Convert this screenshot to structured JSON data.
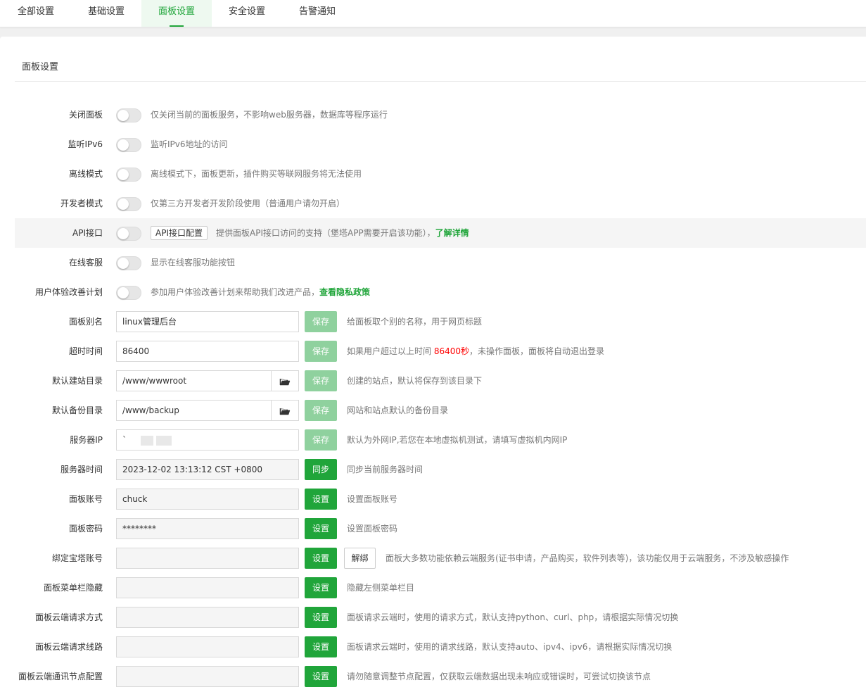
{
  "tabs": [
    {
      "label": "全部设置",
      "active": false
    },
    {
      "label": "基础设置",
      "active": false
    },
    {
      "label": "面板设置",
      "active": true
    },
    {
      "label": "安全设置",
      "active": false
    },
    {
      "label": "告警通知",
      "active": false
    }
  ],
  "panel": {
    "title": "面板设置"
  },
  "toggles": [
    {
      "label": "关闭面板",
      "desc": "仅关闭当前的面板服务，不影响web服务器，数据库等程序运行"
    },
    {
      "label": "监听IPv6",
      "desc": "监听IPv6地址的访问"
    },
    {
      "label": "离线模式",
      "desc": "离线模式下，面板更新，插件购买等联网服务将无法使用"
    },
    {
      "label": "开发者模式",
      "desc": "仅第三方开发者开发阶段使用（普通用户请勿开启）"
    },
    {
      "label": "API接口",
      "button": "API接口配置",
      "desc": "提供面板API接口访问的支持（堡塔APP需要开启该功能），",
      "link": "了解详情"
    },
    {
      "label": "在线客服",
      "desc": "显示在线客服功能按钮"
    },
    {
      "label": "用户体验改善计划",
      "desc": "参加用户体验改善计划来帮助我们改进产品，",
      "link": "查看隐私政策"
    }
  ],
  "fields": {
    "alias": {
      "label": "面板别名",
      "value": "linux管理后台",
      "button": "保存",
      "desc": "给面板取个别的名称，用于网页标题"
    },
    "timeout": {
      "label": "超时时间",
      "value": "86400",
      "button": "保存",
      "desc_pre": "如果用户超过以上时间 ",
      "desc_red": "86400秒",
      "desc_post": "，未操作面板，面板将自动退出登录"
    },
    "site_dir": {
      "label": "默认建站目录",
      "value": "/www/wwwroot",
      "button": "保存",
      "desc": "创建的站点，默认将保存到该目录下"
    },
    "backup_dir": {
      "label": "默认备份目录",
      "value": "/www/backup",
      "button": "保存",
      "desc": "网站和站点默认的备份目录"
    },
    "server_ip": {
      "label": "服务器IP",
      "value": "`",
      "button": "保存",
      "desc": "默认为外网IP,若您在本地虚拟机测试，请填写虚拟机内网IP"
    },
    "server_time": {
      "label": "服务器时间",
      "value": "2023-12-02 13:13:12 CST +0800",
      "button": "同步",
      "desc": "同步当前服务器时间"
    },
    "account": {
      "label": "面板账号",
      "value": "chuck",
      "button": "设置",
      "desc": "设置面板账号"
    },
    "password": {
      "label": "面板密码",
      "value": "********",
      "button": "设置",
      "desc": "设置面板密码"
    },
    "bt_account": {
      "label": "绑定宝塔账号",
      "value": "",
      "button": "设置",
      "button2": "解绑",
      "desc": "面板大多数功能依赖云端服务(证书申请，产品购买，软件列表等)，该功能仅用于云端服务，不涉及敏感操作"
    },
    "menu_hide": {
      "label": "面板菜单栏隐藏",
      "value": "",
      "button": "设置",
      "desc": "隐藏左侧菜单栏目"
    },
    "cloud_method": {
      "label": "面板云端请求方式",
      "value": "",
      "button": "设置",
      "desc": "面板请求云端时，使用的请求方式，默认支持python、curl、php，请根据实际情况切换"
    },
    "cloud_line": {
      "label": "面板云端请求线路",
      "value": "",
      "button": "设置",
      "desc": "面板请求云端时，使用的请求线路，默认支持auto、ipv4、ipv6，请根据实际情况切换"
    },
    "cloud_node": {
      "label": "面板云端通讯节点配置",
      "value": "",
      "button": "设置",
      "desc": "请勿随意调整节点配置，仅获取云端数据出现未响应或错误时，可尝试切换该节点"
    }
  },
  "colors": {
    "accent": "#20a53a",
    "accent_light": "#8fd19e",
    "warning": "#ff0000"
  }
}
